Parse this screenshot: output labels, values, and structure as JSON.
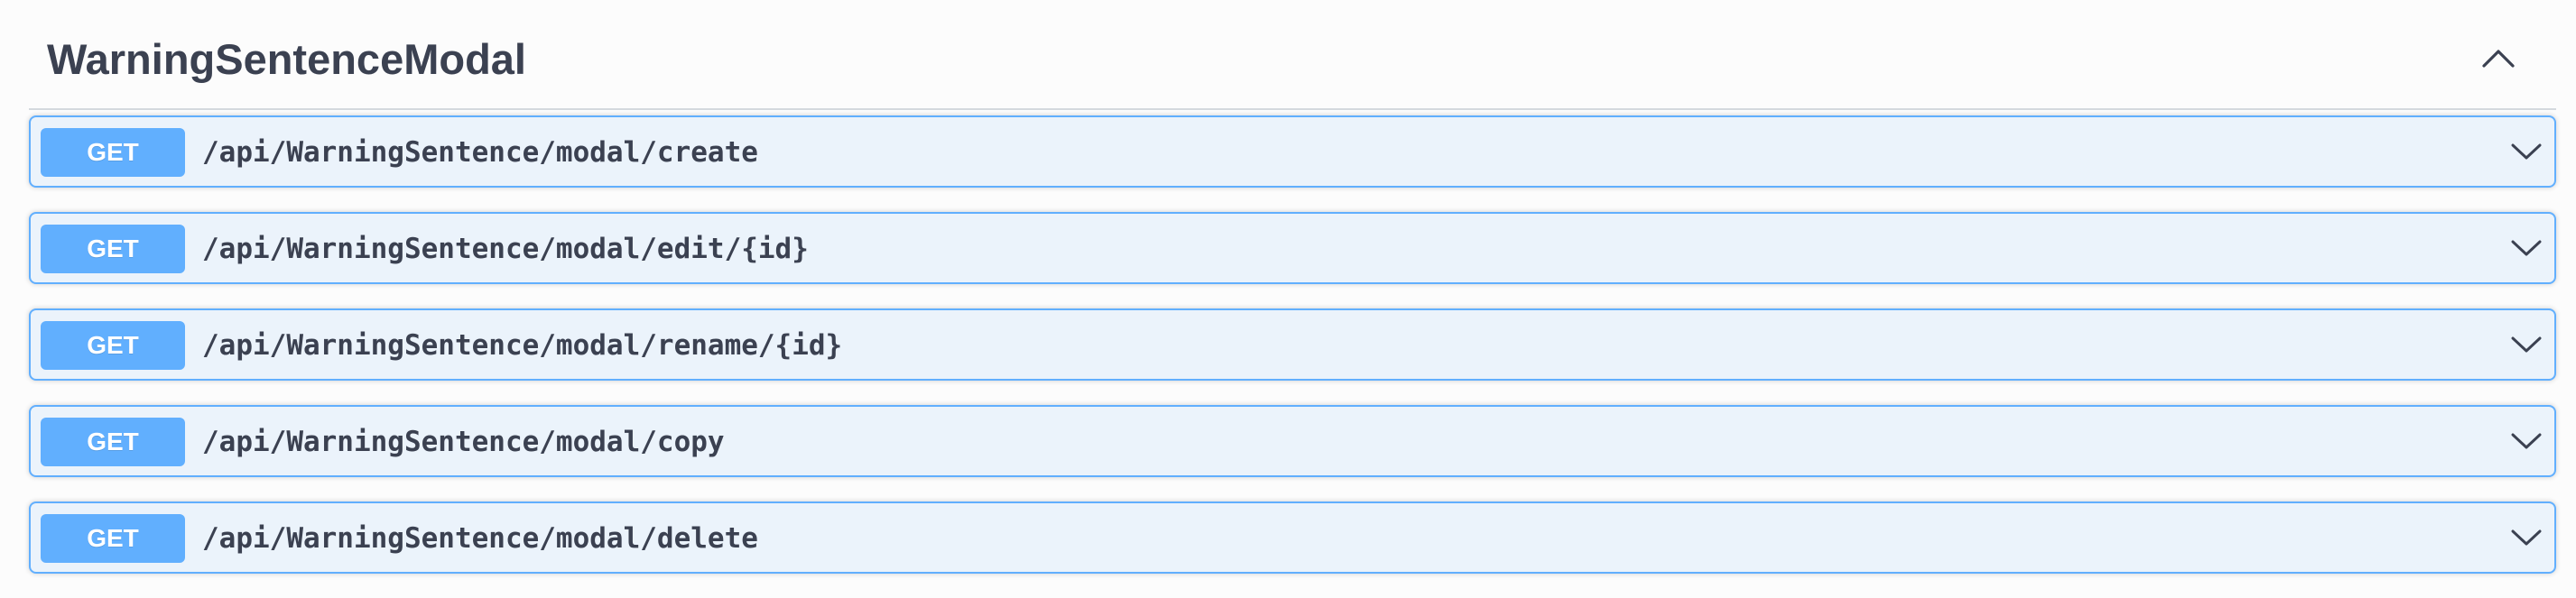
{
  "section": {
    "title": "WarningSentenceModal"
  },
  "operations": [
    {
      "method": "GET",
      "path": "/api/WarningSentence/modal/create"
    },
    {
      "method": "GET",
      "path": "/api/WarningSentence/modal/edit/{id}"
    },
    {
      "method": "GET",
      "path": "/api/WarningSentence/modal/rename/{id}"
    },
    {
      "method": "GET",
      "path": "/api/WarningSentence/modal/copy"
    },
    {
      "method": "GET",
      "path": "/api/WarningSentence/modal/delete"
    }
  ],
  "icons": {
    "collapse": "chevron-up-icon",
    "expand": "chevron-down-icon"
  },
  "colors": {
    "get_method": "#61affe",
    "op_background": "#ebf3fb",
    "text": "#3b4151"
  }
}
